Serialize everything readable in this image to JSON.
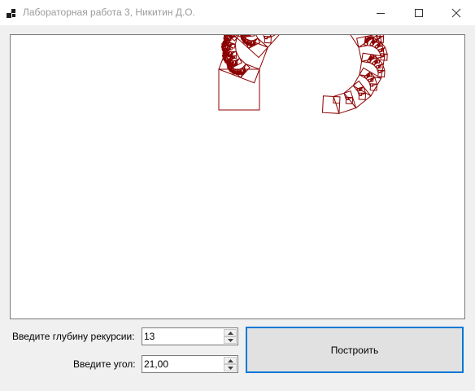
{
  "window": {
    "title": "Лабораторная работа 3, Никитин Д.О."
  },
  "controls": {
    "depth_label": "Введите глубину рекурсии:",
    "depth_value": "13",
    "angle_label": "Введите угол:",
    "angle_value": "21,00",
    "build_label": "Построить"
  },
  "fractal": {
    "type": "pythagoras-tree",
    "depth": 13,
    "angle_deg": 21,
    "color": "#8b0000"
  }
}
